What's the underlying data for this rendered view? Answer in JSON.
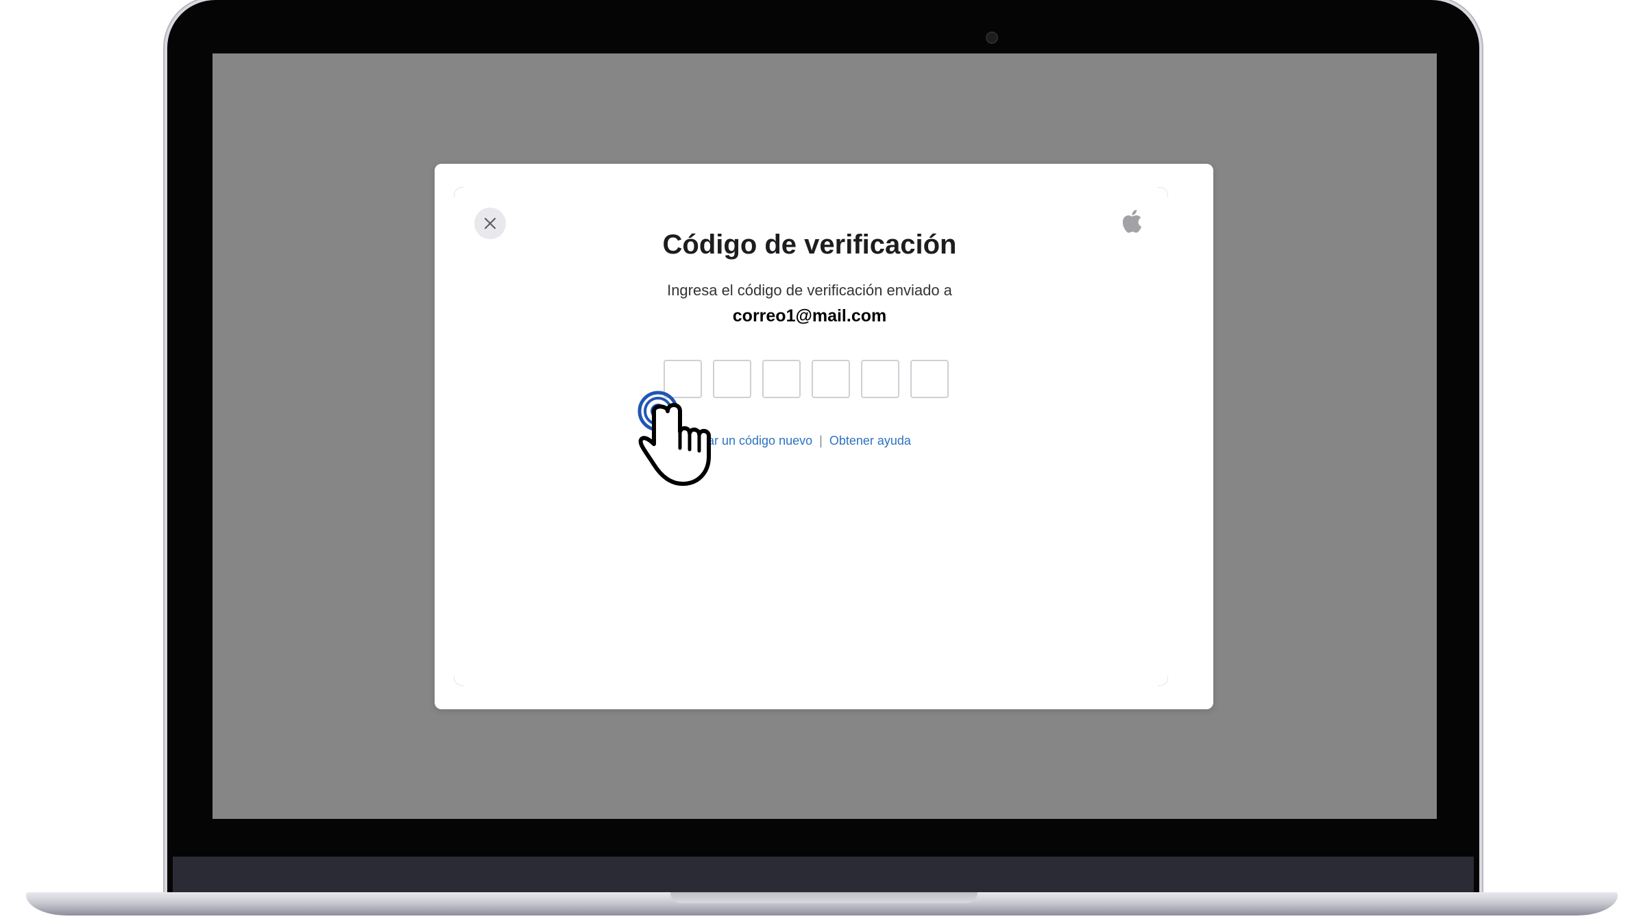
{
  "dialog": {
    "title": "Código de verificación",
    "subtitle": "Ingresa el código de verificación enviado a",
    "email": "correo1@mail.com",
    "code_digits": [
      "",
      "",
      "",
      "",
      "",
      ""
    ],
    "links": {
      "new_code": "Solicitar un código nuevo",
      "new_code_visible": "citar un código nuevo",
      "separator": "|",
      "help": "Obtener ayuda"
    }
  },
  "icons": {
    "close": "close-icon",
    "logo": "apple-logo-icon",
    "pointer": "hand-pointer-icon"
  },
  "colors": {
    "screen_background": "#868686",
    "link": "#2d72c0",
    "pointer_accent": "#1f56b3"
  }
}
